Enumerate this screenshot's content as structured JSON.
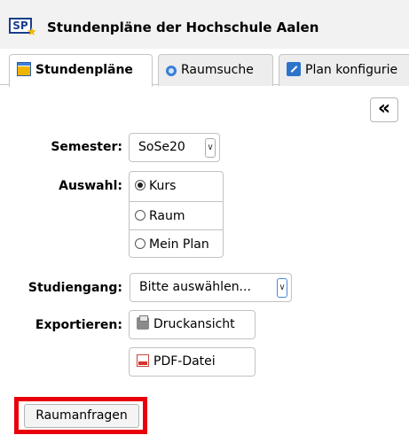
{
  "header": {
    "logo_text": "SP",
    "title": "Stundenpläne der Hochschule Aalen"
  },
  "tabs": [
    {
      "label": "Stundenpläne",
      "icon": "timetable-icon",
      "active": true
    },
    {
      "label": "Raumsuche",
      "icon": "search-icon",
      "active": false
    },
    {
      "label": "Plan konfigurie",
      "icon": "edit-icon",
      "active": false
    }
  ],
  "collapse_button": {
    "symbol": "«"
  },
  "form": {
    "semester": {
      "label": "Semester:",
      "value": "SoSe20"
    },
    "auswahl": {
      "label": "Auswahl:",
      "options": [
        {
          "label": "Kurs",
          "checked": true
        },
        {
          "label": "Raum",
          "checked": false
        },
        {
          "label": "Mein Plan",
          "checked": false
        }
      ]
    },
    "studiengang": {
      "label": "Studiengang:",
      "value": "Bitte auswählen..."
    },
    "export": {
      "label": "Exportieren:",
      "print_label": "Druckansicht",
      "pdf_label": "PDF-Datei"
    },
    "room_request_label": "Raumanfragen"
  },
  "colors": {
    "highlight": "#e8000b",
    "brand": "#1a3e8c",
    "header_bg": "#f2f2f2"
  }
}
